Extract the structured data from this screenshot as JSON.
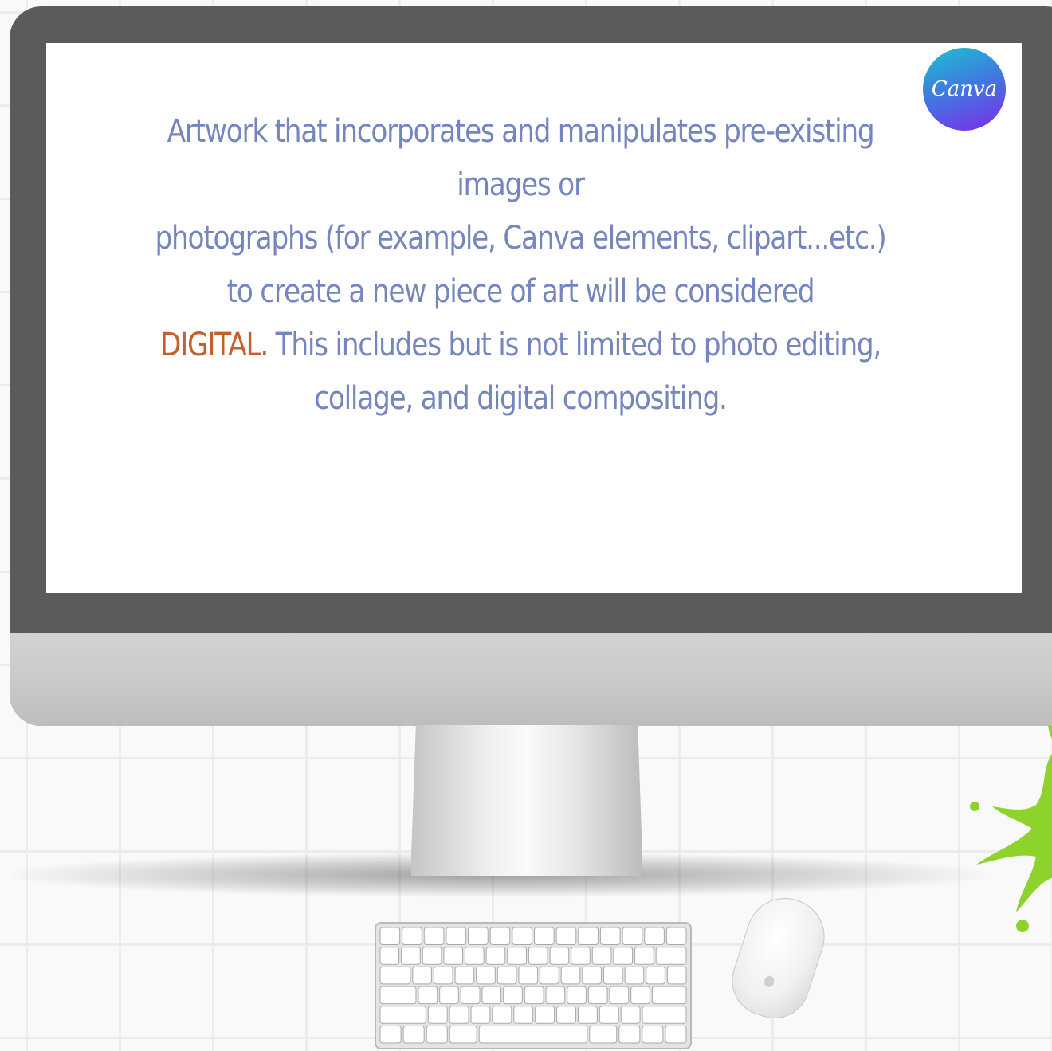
{
  "screen": {
    "text_line_1": "Artwork that incorporates and manipulates pre-existing images or",
    "text_line_2": "photographs (for example, Canva elements, clipart...etc.) to create a new piece of art will be considered",
    "highlight_word": "DIGITAL.",
    "text_line_3": " This includes but is not limited to photo editing, collage, and digital compositing."
  },
  "logo": {
    "text": "Canva"
  },
  "colors": {
    "text": "#7586bf",
    "highlight": "#c3602e",
    "bezel": "#5b5b5b",
    "splash": "#8dd32b"
  },
  "icons": [
    "canva-logo",
    "keyboard-icon",
    "mouse-icon",
    "apple-logo-icon",
    "paint-splash-icon"
  ]
}
